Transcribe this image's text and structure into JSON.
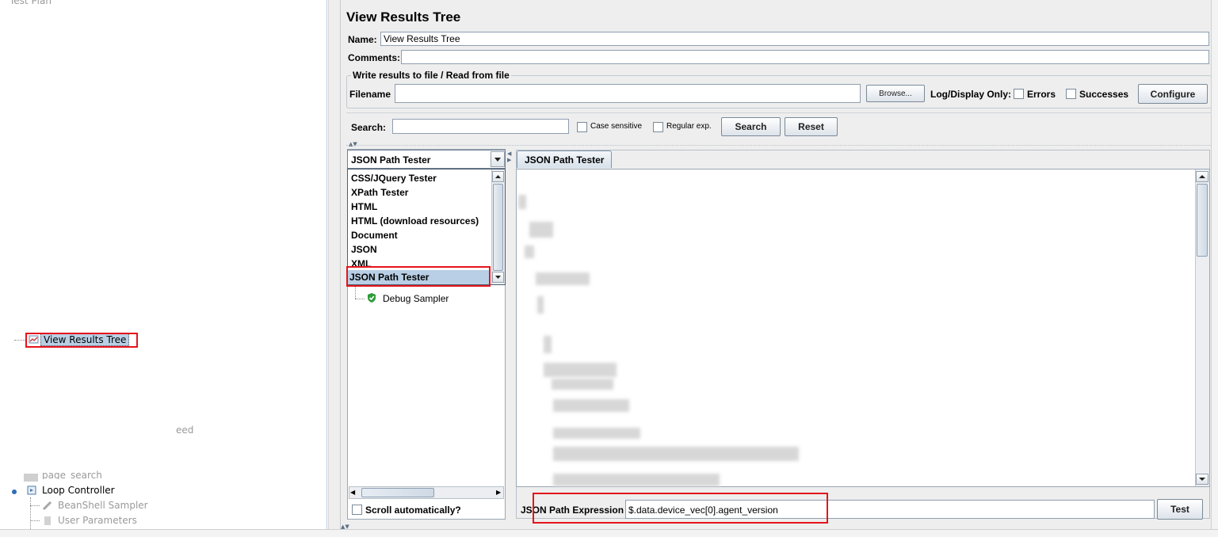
{
  "left_tree": {
    "top_label": "Test Plan",
    "selected_item": "View Results Tree",
    "faded_text": "eed",
    "page_search": "page_search",
    "loop_controller": "Loop Controller",
    "beanshell": "BeanShell Sampler",
    "user_params": "User Parameters"
  },
  "panel": {
    "title": "View Results Tree",
    "name_label": "Name:",
    "name_value": "View Results Tree",
    "comments_label": "Comments:",
    "comments_value": ""
  },
  "file_group": {
    "legend": "Write results to file / Read from file",
    "filename_label": "Filename",
    "filename_value": "",
    "browse_label": "Browse...",
    "log_label": "Log/Display Only:",
    "errors_label": "Errors",
    "successes_label": "Successes",
    "configure_label": "Configure"
  },
  "search": {
    "label": "Search:",
    "value": "",
    "case_label": "Case sensitive",
    "regex_label": "Regular exp.",
    "search_button": "Search",
    "reset_button": "Reset"
  },
  "renderer": {
    "selected": "JSON Path Tester",
    "options": [
      "CSS/JQuery Tester",
      "XPath Tester",
      "HTML",
      "HTML (download resources)",
      "Document",
      "JSON",
      "XML",
      "JSON Path Tester"
    ]
  },
  "tree": {
    "debug_sampler": "Debug Sampler",
    "scroll_label": "Scroll automatically?"
  },
  "tester": {
    "tab_label": "JSON Path Tester",
    "expr_label": "JSON Path Expression",
    "expr_value": "$.data.device_vec[0].agent_version",
    "test_button": "Test"
  },
  "colors": {
    "highlight_red": "#e5141b",
    "selection_blue": "#b8cfe5",
    "panel_bg": "#eeeeee"
  }
}
